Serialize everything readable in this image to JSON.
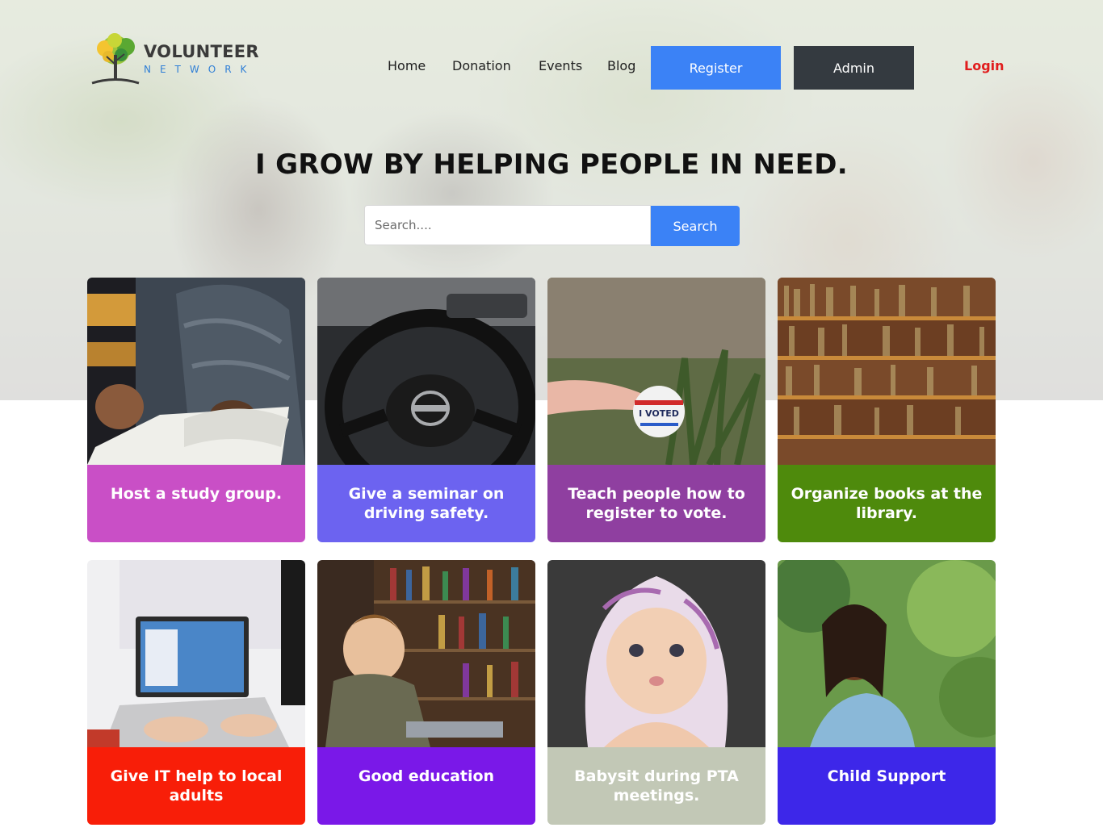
{
  "brand": {
    "title": "VOLUNTEER",
    "subtitle": "NETWORK"
  },
  "nav": {
    "home": "Home",
    "donation": "Donation",
    "events": "Events",
    "blog": "Blog",
    "register": "Register",
    "admin": "Admin",
    "login": "Login"
  },
  "hero": {
    "headline": "I GROW BY HELPING PEOPLE IN NEED.",
    "search_placeholder": "Search....",
    "search_button": "Search"
  },
  "cards": [
    {
      "caption": "Host a study group.",
      "color": "#c94fc6",
      "image": "study-group-image"
    },
    {
      "caption": "Give a seminar on driving safety.",
      "color": "#6c63f0",
      "image": "steering-wheel-image"
    },
    {
      "caption": "Teach people how to register to vote.",
      "color": "#8f3fa0",
      "image": "i-voted-sticker-image",
      "sticker_text": "I VOTED"
    },
    {
      "caption": "Organize books at the library.",
      "color": "#4e8a0c",
      "image": "bookshelf-image"
    },
    {
      "caption": "Give IT help to local adults",
      "color": "#f81e08",
      "image": "laptop-image"
    },
    {
      "caption": "Good education",
      "color": "#7a18e8",
      "image": "child-reading-image"
    },
    {
      "caption": "Babysit during PTA meetings.",
      "color": "#c2c8b6",
      "image": "baby-image"
    },
    {
      "caption": "Child Support",
      "color": "#3d27e9",
      "image": "girl-outdoors-image"
    }
  ]
}
